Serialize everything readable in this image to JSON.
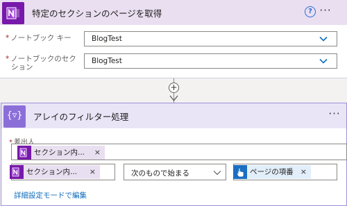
{
  "action1": {
    "title": "特定のセクションのページを取得",
    "icon": "onenote-icon",
    "help_label": "?",
    "more_label": "···",
    "fields": [
      {
        "label": "ノートブック キー",
        "required_mark": "*",
        "value": "BlogTest"
      },
      {
        "label_line1": "ノートブックのセク",
        "label_line2": "ション",
        "required_mark": "*",
        "value": "BlogTest"
      }
    ]
  },
  "connector": {
    "add_label": "+"
  },
  "action2": {
    "title": "アレイのフィルター処理",
    "icon": "filter-array-icon",
    "icon_glyph": "{▿}",
    "more_label": "···",
    "from_label": "差出人",
    "from_required_mark": "*",
    "from_token": {
      "label": "セクション内...",
      "close": "×"
    },
    "condition": {
      "left_token": {
        "label": "セクション内...",
        "close": "×"
      },
      "operator": "次のもので始まる",
      "right_token": {
        "label": "ページの項番",
        "close": "×"
      }
    },
    "advanced_link": "詳細設定モードで編集"
  },
  "colors": {
    "onenote_purple": "#7719aa",
    "filter_purple": "#8c6ed8",
    "header1_bg": "#e9dff0",
    "header2_bg": "#e9e5f7",
    "link_blue": "#0f6cbd",
    "chevron_blue": "#0f6cbd",
    "manual_trigger_blue": "#1b6ec2"
  }
}
